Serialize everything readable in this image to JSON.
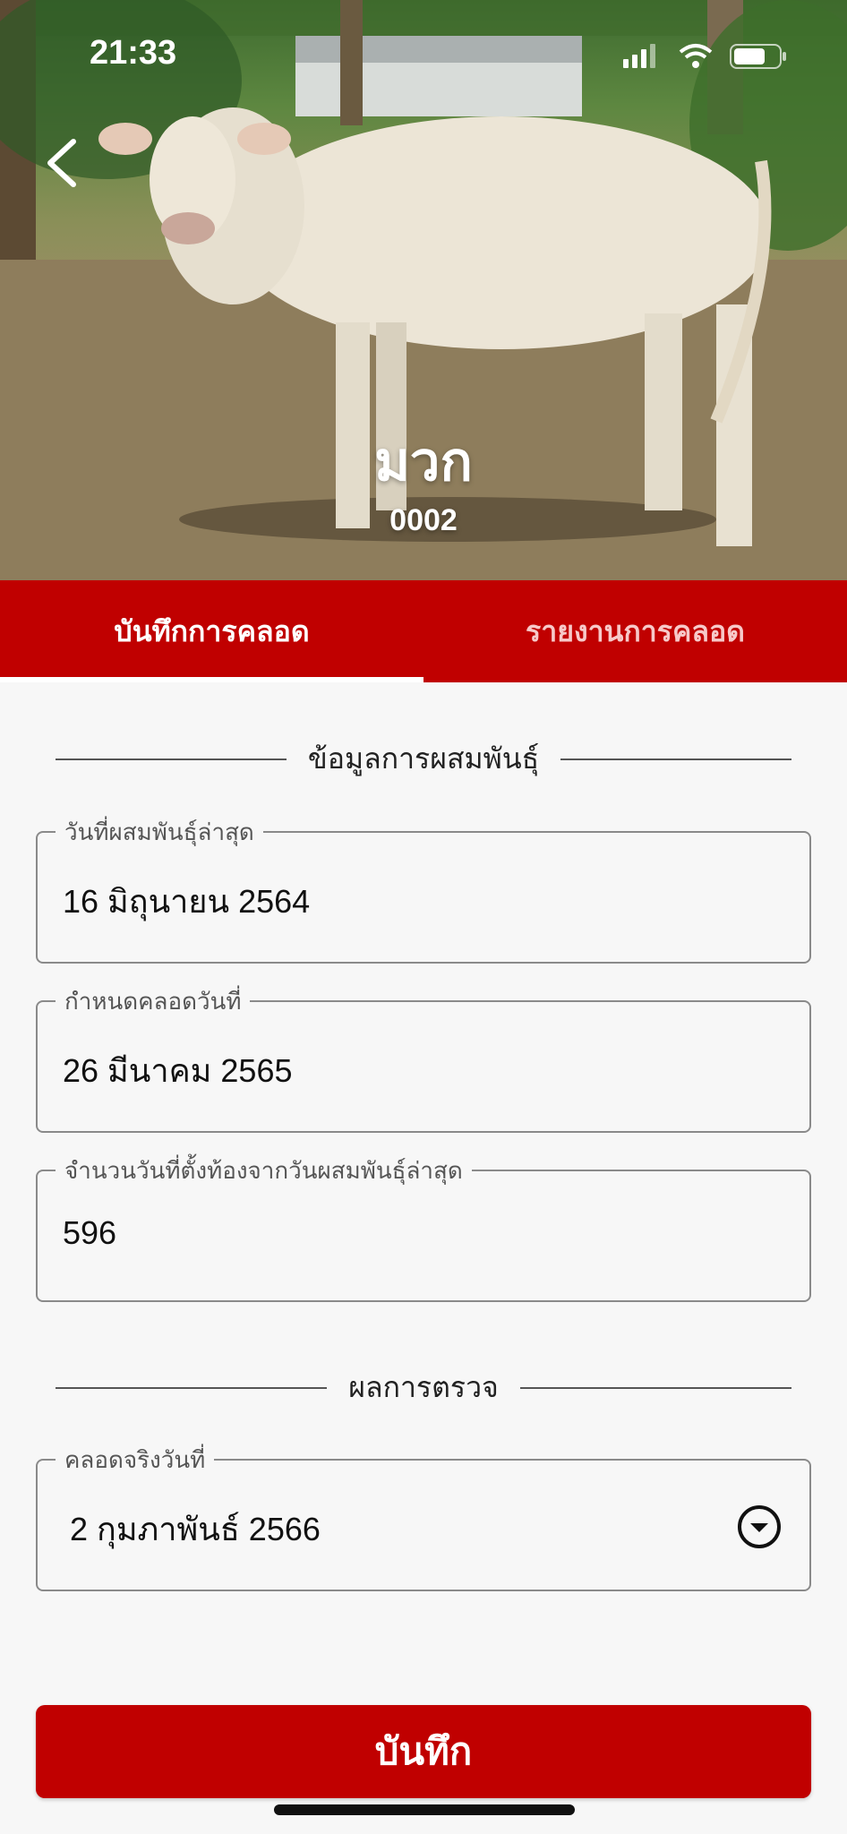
{
  "status_bar": {
    "time": "21:33"
  },
  "hero": {
    "name": "มวก",
    "id": "0002"
  },
  "tabs": [
    {
      "label": "บันทึกการคลอด",
      "active": true
    },
    {
      "label": "รายงานการคลอด",
      "active": false
    }
  ],
  "breeding_section": {
    "heading": "ข้อมูลการผสมพันธุ์",
    "fields": [
      {
        "label": "วันที่ผสมพันธุ์ล่าสุด",
        "value": "16 มิถุนายน 2564"
      },
      {
        "label": "กำหนดคลอดวันที่",
        "value": "26 มีนาคม 2565"
      },
      {
        "label": "จำนวนวันที่ตั้งท้องจากวันผสมพันธุ์ล่าสุด",
        "value": "596"
      }
    ]
  },
  "result_section": {
    "heading": "ผลการตรวจ",
    "actual_birth": {
      "label": "คลอดจริงวันที่",
      "value": "2 กุมภาพันธ์ 2566"
    }
  },
  "save_button": {
    "label": "บันทึก"
  },
  "colors": {
    "primary": "#c00000",
    "background": "#f7f7f7"
  },
  "icons": [
    "back-chevron-icon",
    "signal-icon",
    "wifi-icon",
    "battery-icon",
    "dropdown-chevron-icon"
  ]
}
